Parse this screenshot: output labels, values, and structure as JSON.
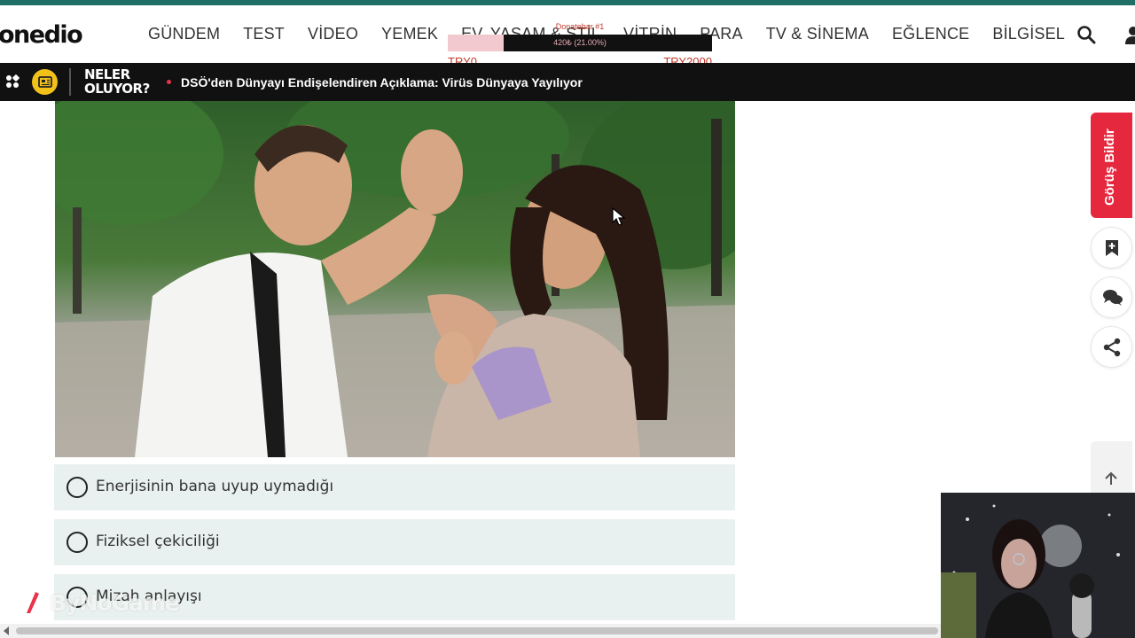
{
  "header": {
    "logo": "onedio",
    "nav": [
      "GÜNDEM",
      "TEST",
      "VİDEO",
      "YEMEK",
      "EV, YAŞAM & STİL",
      "VİTRİN",
      "PARA",
      "TV & SİNEMA",
      "EĞLENCE",
      "BİLGİSEL"
    ],
    "search_icon": "search-icon",
    "user_icon": "user-icon"
  },
  "donate_bar": {
    "title": "Donatebar #1",
    "progress_text": "420₺ (21.00%)",
    "progress_fraction": 0.21,
    "min_label": "TRY0",
    "max_label": "TRY2000",
    "color": "#c0392b"
  },
  "ticker": {
    "label": "NELER OLUYOR?",
    "headline": "DSÖ'den Dünyayı Endişelendiren Açıklama: Virüs Dünyaya Yayılıyor",
    "accent": "#e8334a"
  },
  "quiz": {
    "options": [
      "Enerjisinin bana uyup uymadığı",
      "Fiziksel çekiciliği",
      "Mizah anlayışı"
    ]
  },
  "sidebar": {
    "feedback_label": "Görüş Bildir",
    "feedback_color": "#e6283f",
    "buttons": [
      "bookmark-add-icon",
      "comments-icon",
      "share-icon"
    ],
    "scroll_top_icon": "arrow-up-icon"
  },
  "watermark": {
    "text": "ByNoGame"
  }
}
